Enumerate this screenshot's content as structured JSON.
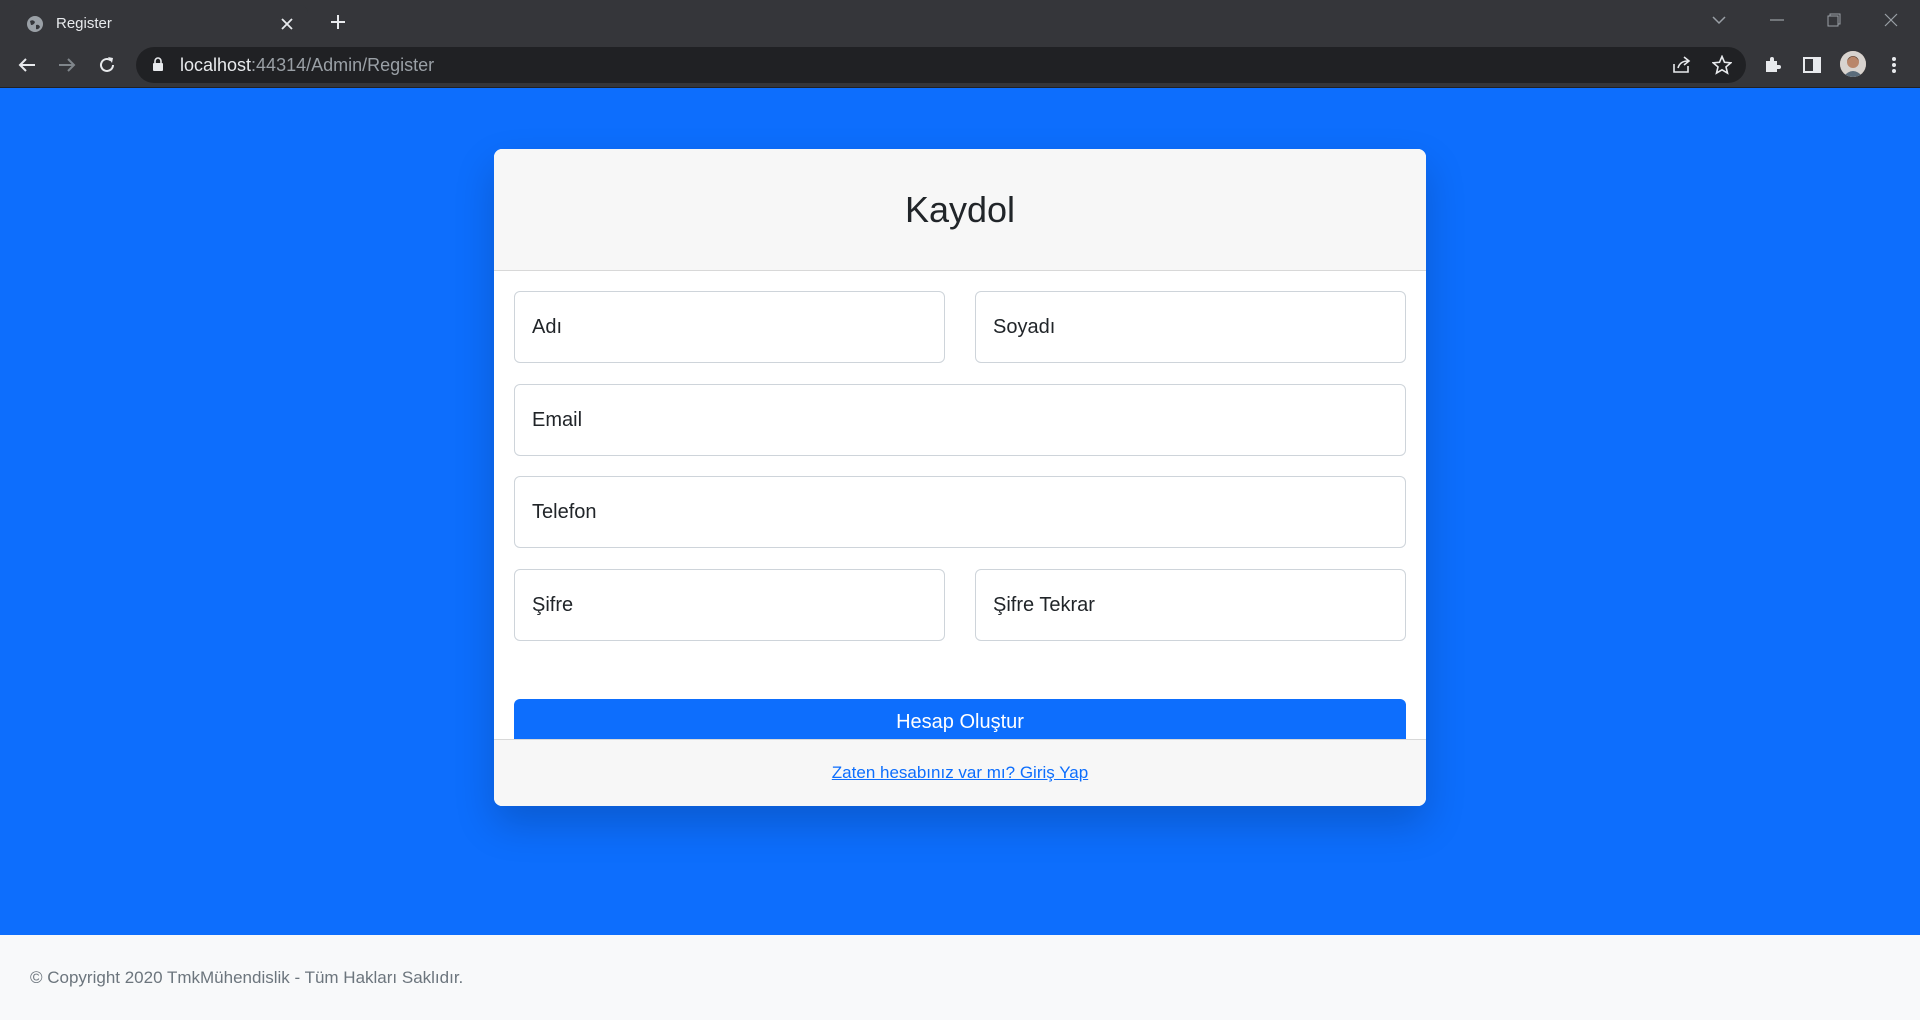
{
  "browser": {
    "tab_title": "Register",
    "url_host": "localhost",
    "url_path": ":44314/Admin/Register"
  },
  "form": {
    "heading": "Kaydol",
    "first_name_placeholder": "Adı",
    "last_name_placeholder": "Soyadı",
    "email_placeholder": "Email",
    "phone_placeholder": "Telefon",
    "password_placeholder": "Şifre",
    "password_repeat_placeholder": "Şifre Tekrar",
    "submit_label": "Hesap Oluştur",
    "login_link": "Zaten hesabınız var mı? Giriş Yap"
  },
  "footer": {
    "copyright": "© Copyright 2020 TmkMühendislik - Tüm Hakları Saklıdır."
  },
  "colors": {
    "primary": "#0d6efd",
    "chrome_dark": "#35363a",
    "omnibox_bg": "#202124"
  }
}
